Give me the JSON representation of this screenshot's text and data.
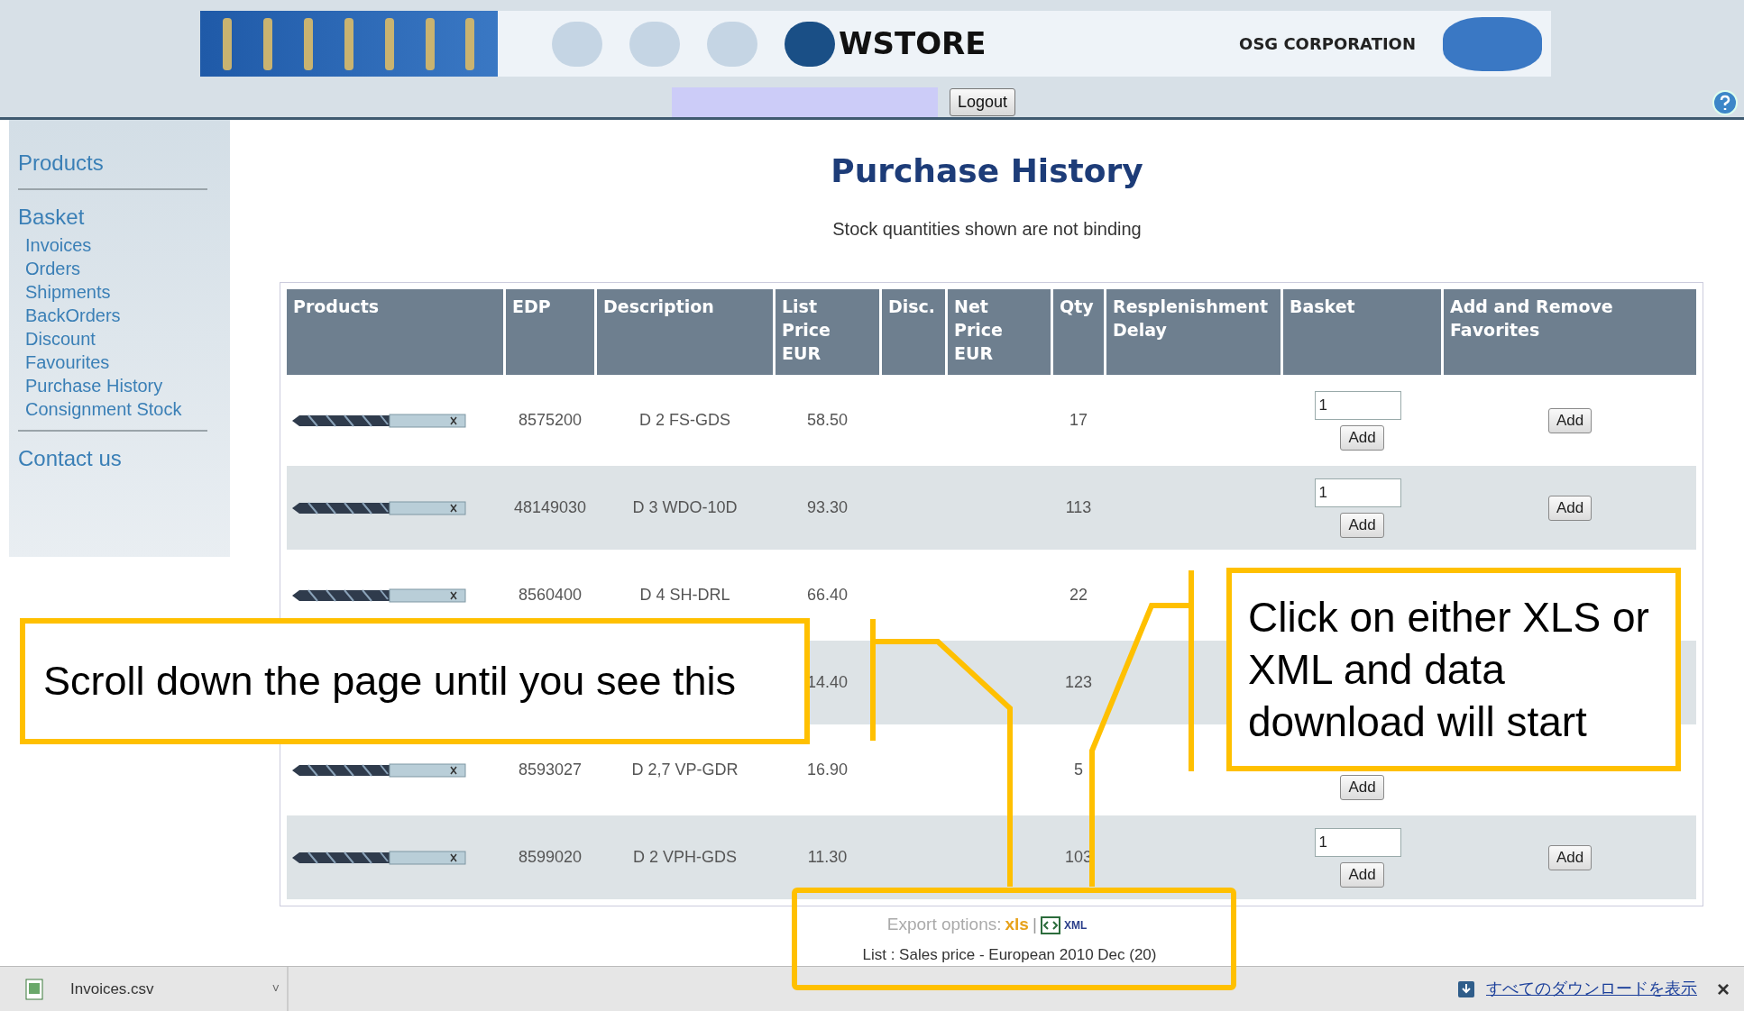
{
  "header": {
    "brand": "WSTORE",
    "company": "OSG CORPORATION",
    "logout": "Logout"
  },
  "sidebar": {
    "sections": [
      {
        "label": "Products"
      },
      {
        "label": "Basket",
        "children": [
          {
            "label": "Invoices"
          },
          {
            "label": "Orders"
          },
          {
            "label": "Shipments"
          },
          {
            "label": "BackOrders"
          },
          {
            "label": "Discount"
          },
          {
            "label": "Favourites"
          },
          {
            "label": "Purchase History"
          },
          {
            "label": "Consignment Stock"
          }
        ]
      },
      {
        "label": "Contact us"
      }
    ]
  },
  "page": {
    "title": "Purchase History",
    "subtitle": "Stock quantities shown are not binding"
  },
  "table": {
    "columns": [
      "Products",
      "EDP",
      "Description",
      "List Price EUR",
      "Disc.",
      "Net Price EUR",
      "Qty",
      "Resplenishment Delay",
      "Basket",
      "Add and Remove Favorites"
    ],
    "rows": [
      {
        "image": true,
        "edp": "8575200",
        "description": "D 2 FS-GDS",
        "list_price": "58.50",
        "qty": "17",
        "basket": {
          "quantity": "1",
          "button": "Add"
        },
        "favorite_button": "Add"
      },
      {
        "image": true,
        "edp": "48149030",
        "description": "D 3 WDO-10D",
        "list_price": "93.30",
        "qty": "113",
        "basket": {
          "quantity": "1",
          "button": "Add"
        },
        "favorite_button": "Add"
      },
      {
        "image": true,
        "edp": "8560400",
        "description": "D 4 SH-DRL",
        "list_price": "66.40",
        "qty": "22"
      },
      {
        "image": false,
        "list_price": "14.40",
        "qty": "123"
      },
      {
        "image": true,
        "edp": "8593027",
        "description": "D 2,7 VP-GDR",
        "list_price": "16.90",
        "qty": "5",
        "basket": {
          "button": "Add"
        }
      },
      {
        "image": true,
        "edp": "8599020",
        "description": "D 2 VPH-GDS",
        "list_price": "11.30",
        "qty": "103",
        "basket": {
          "quantity": "1",
          "button": "Add"
        },
        "favorite_button": "Add"
      }
    ]
  },
  "export": {
    "label": "Export options:",
    "xls": "xls",
    "separator": "|",
    "xml": "XML",
    "price_list": "List : Sales price - European 2010 Dec (20)"
  },
  "callouts": [
    {
      "text": "Scroll down the page until you see this"
    },
    {
      "text": "Click on either XLS or XML and data download will start"
    }
  ],
  "download_bar": {
    "file": "Invoices.csv",
    "caret": "˅",
    "show_all": "すべてのダウンロードを表示",
    "close": "×"
  }
}
